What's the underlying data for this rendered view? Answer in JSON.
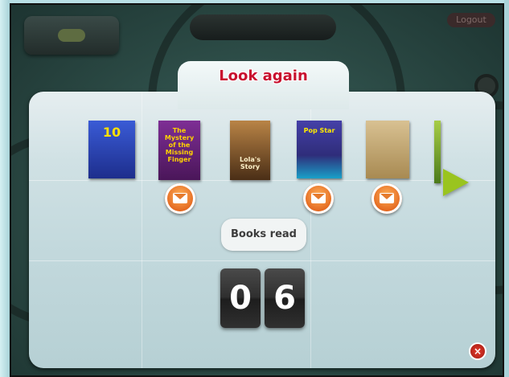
{
  "header": {
    "center_pill_text": "",
    "logout_label": "Logout"
  },
  "dialog": {
    "title": "Look again",
    "books": [
      {
        "name": "book-1",
        "title": "10",
        "has_message": false,
        "color": "#1d2e8c"
      },
      {
        "name": "book-2",
        "title": "The Mystery of the Missing Finger",
        "has_message": true,
        "color": "#5a1f6d"
      },
      {
        "name": "book-3",
        "title": "Lola's Story",
        "has_message": false,
        "color": "#5a3a1c"
      },
      {
        "name": "book-4",
        "title": "Pop Star",
        "has_message": true,
        "color": "#2f2d7a"
      },
      {
        "name": "book-5",
        "title": "",
        "has_message": true,
        "color": "#c2a773"
      },
      {
        "name": "book-6",
        "title": "",
        "has_message": false,
        "color": "#8fb43a"
      }
    ],
    "books_read_label": "Books read",
    "books_read_digits": [
      "0",
      "6"
    ],
    "close_icon": "×"
  }
}
